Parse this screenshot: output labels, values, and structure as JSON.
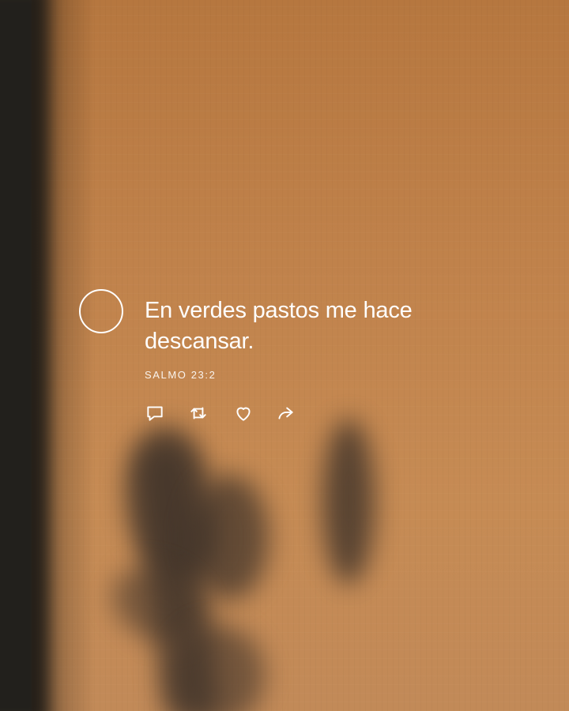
{
  "post": {
    "text": "En verdes pastos me hace descansar.",
    "reference": "SALMO 23:2"
  },
  "icons": {
    "avatar": "circle-outline",
    "reply": "comment-icon",
    "repost": "repost-icon",
    "like": "heart-icon",
    "share": "share-icon"
  },
  "colors": {
    "background": "#c1834c",
    "text": "#ffffff",
    "shadow": "#22201c"
  }
}
